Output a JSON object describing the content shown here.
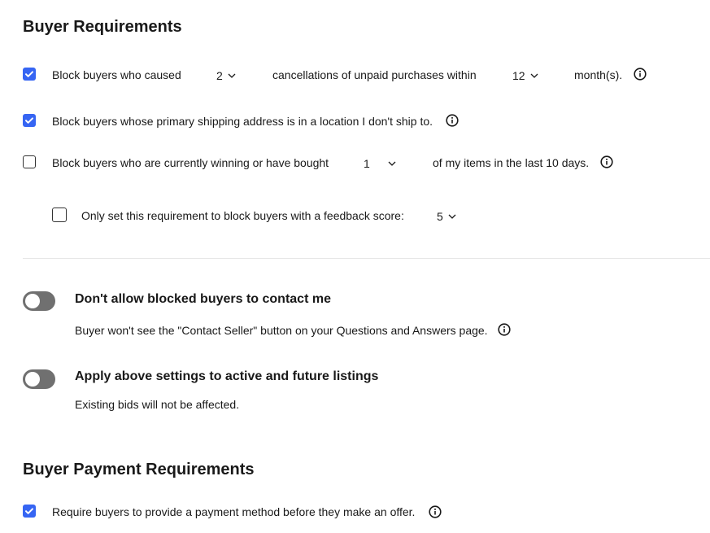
{
  "sections": {
    "buyer_requirements": {
      "title": "Buyer Requirements",
      "rule1": {
        "checked": true,
        "label_before": "Block buyers who caused",
        "count_value": "2",
        "label_middle": "cancellations of unpaid purchases within",
        "months_value": "12",
        "label_after": "month(s)."
      },
      "rule2": {
        "checked": true,
        "label": "Block buyers whose primary shipping address is in a location I don't ship to."
      },
      "rule3": {
        "checked": false,
        "label_before": "Block buyers who are currently winning or have bought",
        "items_value": "1",
        "label_after": "of my items in the last 10 days."
      },
      "rule3_sub": {
        "checked": false,
        "label": "Only set this requirement to block buyers with a feedback score:",
        "score_value": "5"
      }
    },
    "toggles": [
      {
        "on": false,
        "title": "Don't allow blocked buyers to contact me",
        "description": "Buyer won't see the \"Contact Seller\" button on your Questions and Answers page."
      },
      {
        "on": false,
        "title": "Apply above settings to active and future listings",
        "description": "Existing bids will not be affected."
      }
    ],
    "buyer_payment_requirements": {
      "title": "Buyer Payment Requirements",
      "rule1": {
        "checked": true,
        "label": "Require buyers to provide a payment method before they make an offer."
      }
    }
  },
  "icons": {
    "checkbox_checked": "checkmark-icon",
    "info": "info-circle-icon",
    "dropdown": "chevron-down-icon"
  },
  "colors": {
    "accent": "#3665f3",
    "toggle_off": "#707070",
    "text": "#191919",
    "divider": "#e5e5e5"
  }
}
